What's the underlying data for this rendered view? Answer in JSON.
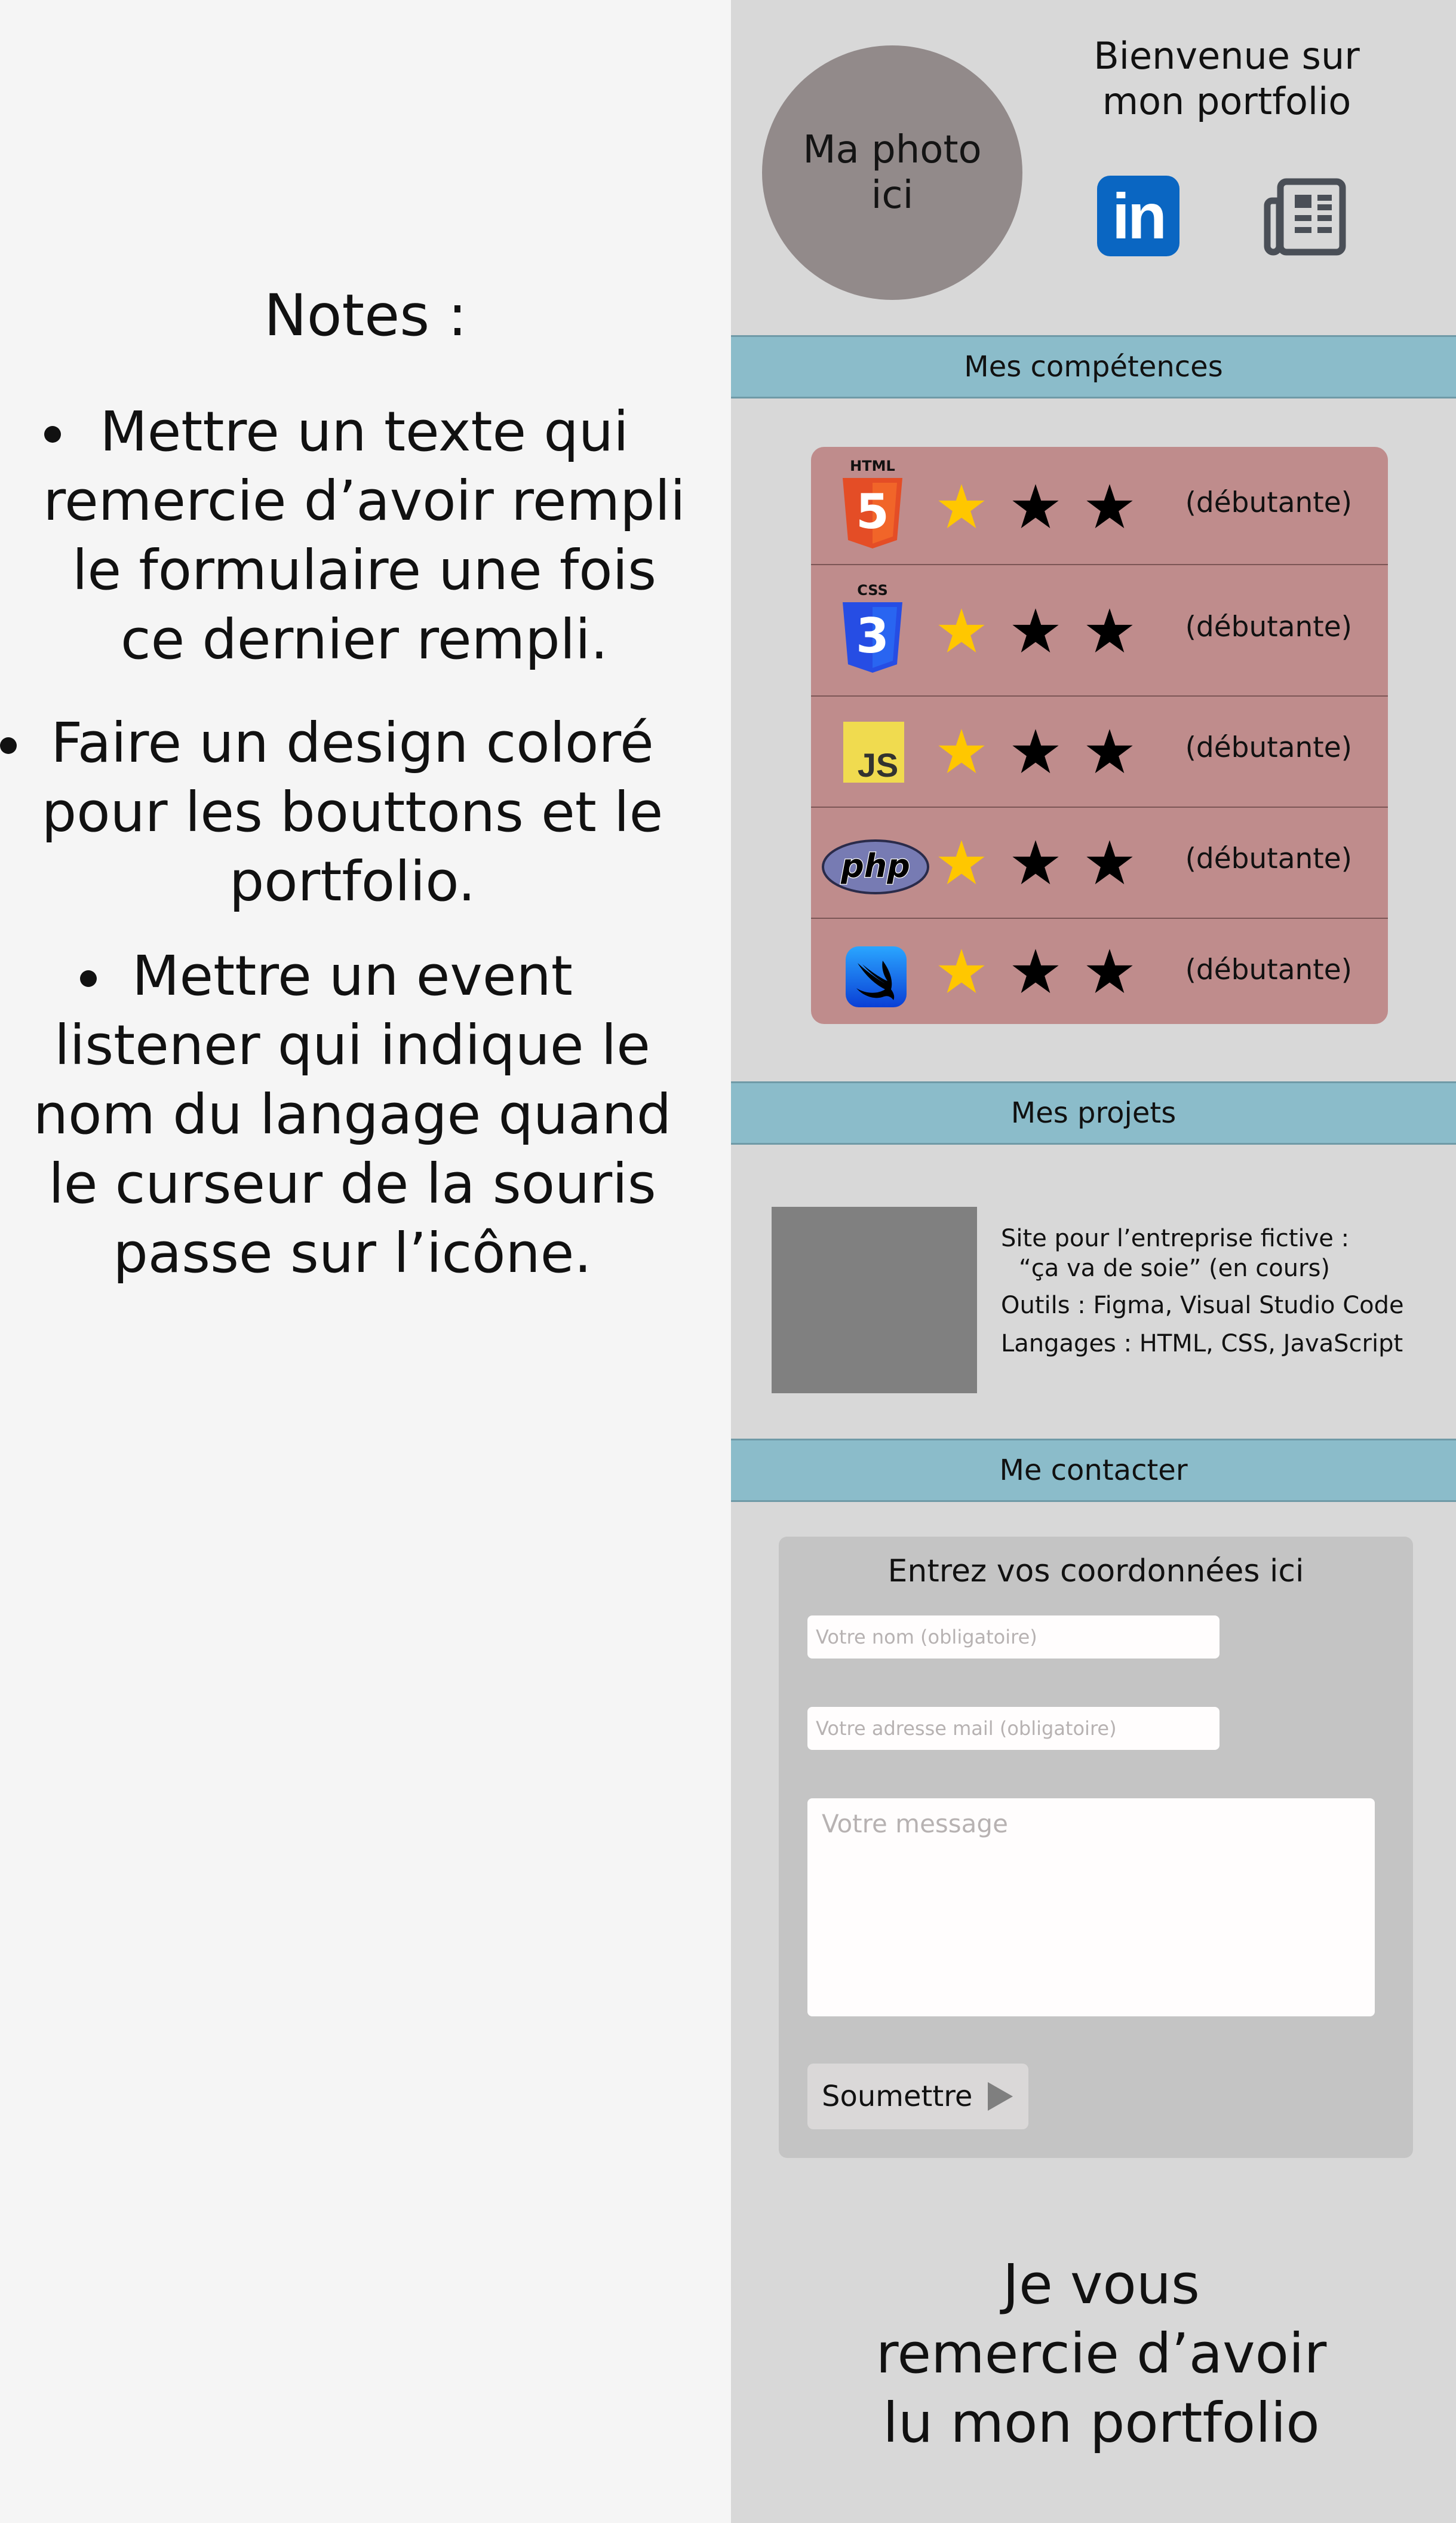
{
  "notes": {
    "title": "Notes :",
    "items": [
      {
        "lines": [
          "Mettre un texte qui",
          "remercie d’avoir rempli",
          "le formulaire une fois",
          "ce dernier rempli."
        ]
      },
      {
        "lines": [
          "Faire un design coloré",
          "pour les bouttons et le",
          "portfolio."
        ]
      },
      {
        "lines": [
          "Mettre un event",
          "listener qui indique le",
          "nom du langage quand",
          "le curseur de la souris",
          "passe sur l’icône."
        ]
      }
    ]
  },
  "header": {
    "photo_lines": [
      "Ma photo",
      "ici"
    ],
    "welcome_lines": [
      "Bienvenue sur",
      "mon portfolio"
    ],
    "linkedin_icon": "linkedin-icon",
    "linkedin_text": "in",
    "news_icon": "newspaper-icon"
  },
  "sections": {
    "skills": "Mes compétences",
    "projects": "Mes projets",
    "contact": "Me contacter"
  },
  "skills": [
    {
      "icon": "html5-icon",
      "logo_label": "HTML",
      "logo_glyph": "5",
      "level": "(débutante)",
      "stars": [
        true,
        false,
        false
      ]
    },
    {
      "icon": "css3-icon",
      "logo_label": "CSS",
      "logo_glyph": "3",
      "level": "(débutante)",
      "stars": [
        true,
        false,
        false
      ]
    },
    {
      "icon": "javascript-icon",
      "logo_glyph": "JS",
      "level": "(débutante)",
      "stars": [
        true,
        false,
        false
      ]
    },
    {
      "icon": "php-icon",
      "logo_glyph": "php",
      "level": "(débutante)",
      "stars": [
        true,
        false,
        false
      ]
    },
    {
      "icon": "swift-icon",
      "level": "(débutante)",
      "stars": [
        true,
        false,
        false
      ]
    }
  ],
  "project": {
    "line1": "Site pour l’entreprise fictive :",
    "line2": "“ça va de soie” (en cours)",
    "tools": "Outils : Figma, Visual Studio Code",
    "languages": "Langages : HTML, CSS, JavaScript"
  },
  "contact": {
    "title": "Entrez vos coordonnées ici",
    "name_placeholder": "Votre nom (obligatoire)",
    "email_placeholder": "Votre adresse mail (obligatoire)",
    "message_placeholder": "Votre message",
    "submit_label": "Soumettre"
  },
  "thanks_lines": [
    "Je vous",
    "remercie d’avoir",
    "lu mon portfolio"
  ],
  "colors": {
    "portfolio_bg": "#d8d8d8",
    "section_bar": "#8bbcca",
    "skills_card": "#bf8c8c",
    "star_active": "#ffc700",
    "star_inactive": "#000000",
    "linkedin": "#0a66c2"
  }
}
